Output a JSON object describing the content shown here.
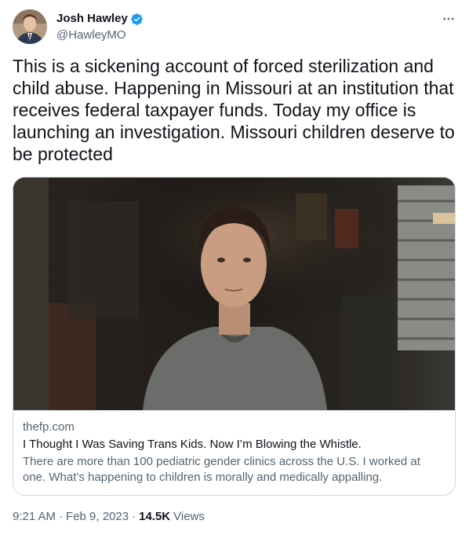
{
  "author": {
    "display_name": "Josh Hawley",
    "handle": "@HawleyMO",
    "verified": true,
    "avatar_icon": "profile-photo"
  },
  "menu": {
    "icon": "more-horizontal-icon"
  },
  "tweet": {
    "text": "This is a sickening account of forced sterilization and child abuse. Happening in Missouri at an institution that receives federal taxpayer funds. Today my office is launching an investigation. Missouri children deserve to be protected"
  },
  "card": {
    "image_icon": "article-photo",
    "domain": "thefp.com",
    "title": "I Thought I Was Saving Trans Kids. Now I’m Blowing the Whistle.",
    "description": "There are more than 100 pediatric gender clinics across the U.S. I worked at one. What’s happening to children is morally and medically appalling."
  },
  "meta": {
    "time": "9:21 AM",
    "separator": "·",
    "date": "Feb 9, 2023",
    "views_count": "14.5K",
    "views_label": "Views"
  },
  "colors": {
    "verified_blue": "#1d9bf0",
    "text_primary": "#0f1419",
    "text_secondary": "#536471",
    "border": "#cfd9de"
  }
}
